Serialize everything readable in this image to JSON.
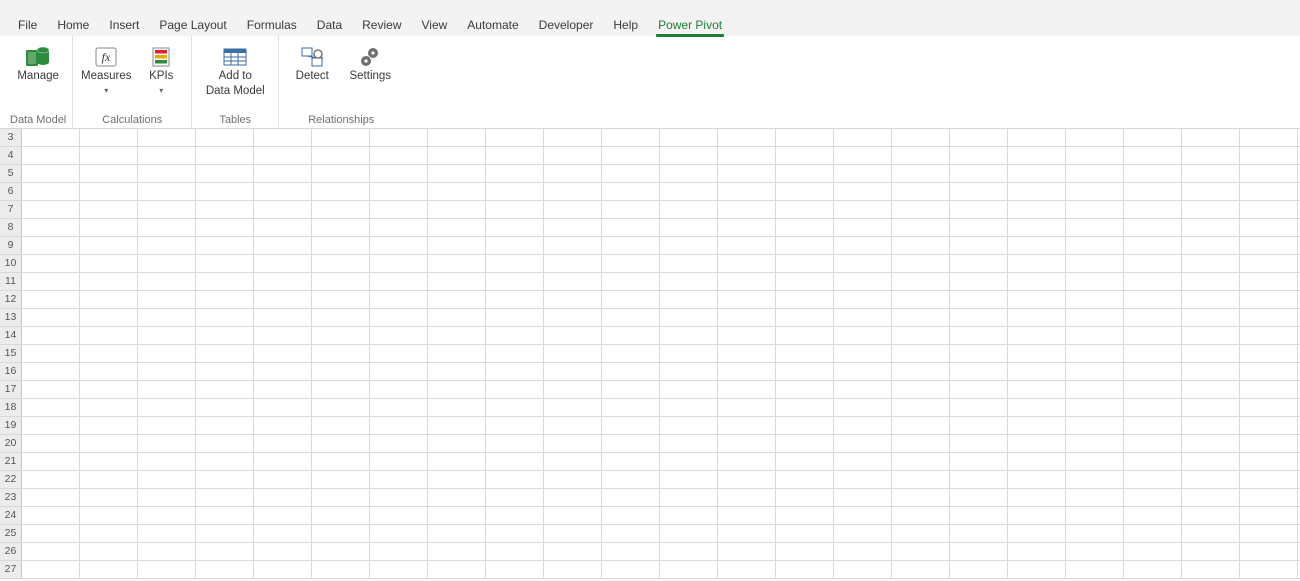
{
  "tabs": {
    "file": "File",
    "home": "Home",
    "insert": "Insert",
    "pagelayout": "Page Layout",
    "formulas": "Formulas",
    "data": "Data",
    "review": "Review",
    "view": "View",
    "automate": "Automate",
    "developer": "Developer",
    "help": "Help",
    "powerpivot": "Power Pivot"
  },
  "active_tab": "powerpivot",
  "ribbon": {
    "groups": {
      "datamodel": "Data Model",
      "calculations": "Calculations",
      "tables": "Tables",
      "relationships": "Relationships"
    },
    "buttons": {
      "manage": "Manage",
      "measures": "Measures",
      "kpis": "KPIs",
      "addtodmL1": "Add to",
      "addtodmL2": "Data Model",
      "detect": "Detect",
      "settings": "Settings"
    }
  },
  "grid": {
    "first_row": 3,
    "last_row": 27,
    "column_count": 22,
    "rows": [
      "3",
      "4",
      "5",
      "6",
      "7",
      "8",
      "9",
      "10",
      "11",
      "12",
      "13",
      "14",
      "15",
      "16",
      "17",
      "18",
      "19",
      "20",
      "21",
      "22",
      "23",
      "24",
      "25",
      "26",
      "27"
    ]
  },
  "icons": {
    "manage": "manage",
    "measures": "fx",
    "kpis": "kpis",
    "addtodm": "table-plus",
    "detect": "detect",
    "settings": "gears"
  }
}
